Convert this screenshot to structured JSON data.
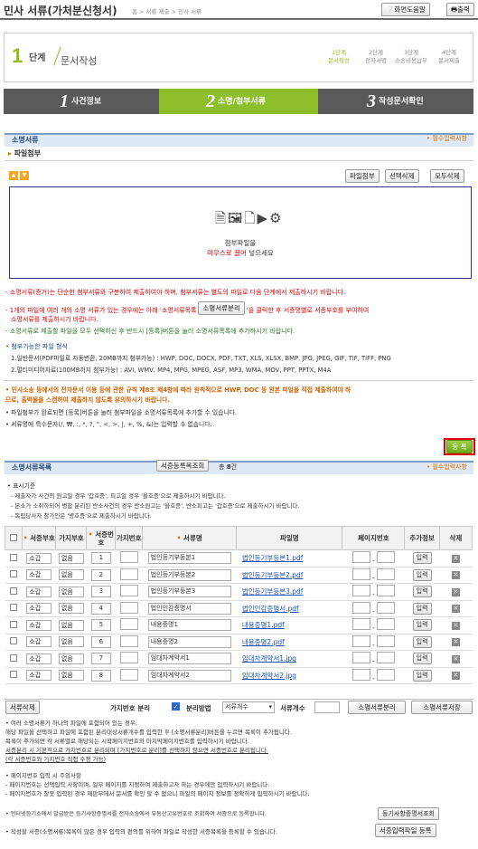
{
  "header": {
    "title": "민사 서류(가처분신청서)",
    "breadcrumb": "홈 > 서류 제출 > 민사 서류",
    "help_label": "화면도움말",
    "print_label": "출력"
  },
  "steps": {
    "current_num": "1",
    "current_unit": "단계",
    "current_name": "문서작성",
    "substeps": [
      [
        "1단계",
        "문서작성"
      ],
      [
        "2단계",
        "전자서명"
      ],
      [
        "3단계",
        "소송비용납부"
      ],
      [
        "4단계",
        "문서제출"
      ]
    ]
  },
  "tabs": [
    {
      "num": "1",
      "label": "사건정보"
    },
    {
      "num": "2",
      "label": "소명/첨부서류"
    },
    {
      "num": "3",
      "label": "작성문서확인"
    }
  ],
  "section1": {
    "title": "소명서류",
    "required": "• 필수입력사항",
    "attach_title": "파일첨부",
    "btn_attach": "파일첨부",
    "btn_delete_selected": "선택삭제",
    "btn_delete_all": "모두삭제",
    "drop_line1": "첨부파일을",
    "drop_line2_red": "마우스로 끌어",
    "drop_line2_rest": " 넣으세요"
  },
  "notes1": {
    "n1": "- 소명서류(증거)는 단순한 첨부서류와 구분하여 제출하여야 하며, 첨부서류는 별도의 파일로 다음 단계에서 제출하시기 바랍니다.",
    "n2a": "- 1개의 파일에 여러 개의 소명 서류가 있는 경우에는 아래 '소명서류목록",
    "n2btn": "소명서류분리",
    "n2b": "'을 클릭한 후 서증명별로 서증부호를 부여하여",
    "n2c": "소명서류를 제출하시기 바랍니다.",
    "n3": "- 소명서류로 제출할 파일을 모두 선택하신 후 반드시 [등록]버튼을 눌러 소명서류목록에 추가하시기 바랍니다.",
    "formats_title": "첨부가능한 파일 형식",
    "f1": "1.일반문서(PDF파일로 자동변환, 20MB까지 첨부가능) : HWP, DOC, DOCX, PDF, TXT, XLS, XLSX, BMP, JPG, JPEG, GIF, TIF, TIFF, PNG",
    "f2": "2.멀티미디어자료(100MB까지 첨부가능) : AVI, WMV, MP4, MPG, MPEG, ASF, MP3, WMA, MOV, PPT, PPTX, M4A",
    "w1": "• 민사소송 등에서의 전자문서 이용 등에 관한 규칙 제8조 제4항에 따라 원칙적으로 HWP, DOC 등 원본 파일을 직접 제출하여야 하",
    "w2": "  므로, 출력물을 스캔하여 제출하지 않도록 유의하시기 바랍니다.",
    "w3": "• 파일첨부가 완료되면 [등록]버튼을 눌러 첨부파일을 소명서류목록에 추가할 수 있습니다.",
    "w4": "• 서류명에 특수문자(/, ₩, :, *, ?, \", <, >, |, +, %, &)는 입력할 수 없습니다.",
    "register": "등 록"
  },
  "section2": {
    "title": "소명서류목록",
    "btn_lookup": "서증등록목조회",
    "count_prefix": "총",
    "count": "8",
    "count_suffix": "건",
    "required": "• 필수입력사항",
    "std_title": "• 표시기준",
    "s1": "- 제출자가 사건의 원고일 경우 '갑호증', 피고일 경우 '을호증'으로 제출하시기 바랍니다.",
    "s2": "- 본소가 소취하되어 병합 분리된 반소사건의 경우 반소원고는 '을호증', 반소피고는 '갑호증'으로 제출하시기 바랍니다.",
    "s3": "- 독립당사자 참가인은 '병호증'으로 제출하시기 바랍니다."
  },
  "table": {
    "headers": [
      "",
      "서증부호",
      "가지부호",
      "서증번호",
      "가지번호",
      "서류명",
      "파일명",
      "페이지번호",
      "추가정보",
      "삭제"
    ],
    "rows": [
      {
        "code": "소갑",
        "branch": "없음",
        "no": "1",
        "name": "법인등기부등본1",
        "file": "법인등기부등본1.pdf",
        "info": "입력"
      },
      {
        "code": "소갑",
        "branch": "없음",
        "no": "2",
        "name": "법인등기부등본2",
        "file": "법인등기부등본2.pdf",
        "info": "입력"
      },
      {
        "code": "소갑",
        "branch": "없음",
        "no": "3",
        "name": "법인등기부등본3",
        "file": "법인등기부등본3.pdf",
        "info": "입력"
      },
      {
        "code": "소갑",
        "branch": "없음",
        "no": "4",
        "name": "법인인감증명서",
        "file": "법인인감증명서.pdf",
        "info": "입력"
      },
      {
        "code": "소갑",
        "branch": "없음",
        "no": "5",
        "name": "내용증명1",
        "file": "내용증명1.pdf",
        "info": "입력"
      },
      {
        "code": "소갑",
        "branch": "없음",
        "no": "6",
        "name": "내용증명2",
        "file": "내용증명2.pdf",
        "info": "입력"
      },
      {
        "code": "소갑",
        "branch": "없음",
        "no": "7",
        "name": "임대차계약서1",
        "file": "임대차계약서1.jpg",
        "info": "입력"
      },
      {
        "code": "소갑",
        "branch": "없음",
        "no": "8",
        "name": "임대차계약서2",
        "file": "임대차계약서2.jpg",
        "info": "입력"
      }
    ]
  },
  "bottombar": {
    "btn_delete": "서류삭제",
    "branch_split": "가지번호 분리",
    "method_label": "분리방법",
    "method_value": "서류개수",
    "count_label": "서류개수",
    "btn_split": "소명서류분리",
    "btn_save": "소명서류저장"
  },
  "notes2": {
    "a1": "• 여러 소명서류가 하나의 파일에 포함되어 있는 경우,",
    "a2": "  해당 파일을 선택하고 파일에 포함된 분리대상서류개수를 입력한 후 [소명서류분리]버튼을 누르면 목록이 추가됩니다.",
    "a3": "  목록이 추가되면 각 서류별로 해당되는 시작페이지번호와 마지막페이지번호를 입력하시기 바랍니다.",
    "a4": "  서증분리 시 기본적으로 가지번호로 분리되며 [가지번호로 분리]를 선택하지 않으면 서증번호로 분리됩니다.",
    "a5": "  (각 서증번호와 가지번호 직접 수정 가능)",
    "b1": "• 페이지번호 입력 시 주의사항",
    "b2": "  - 페이지번호는 선택입력 사항이며, 일부 페이지를 지정하여 제출하고자 하는 경우에만 입력하시기 바랍니다.",
    "b3": "  - 페이지번호가 잘못 입력된 경우 재판부에서 문서를 확인 할 수 없으니 파일의 페이지 정보를 정확하게 입력하시기 바랍니다.",
    "c1": "• 인터넷등기소에서 발급받은 등기사항증명서를 전자소송에서 부동산고유번호로 조회하여 서증으로 등록합니다.",
    "c1btn": "등기사항증명서조회",
    "c2": "• 작성할 서증(소명서류)목록이 많은 경우 입력의 편의를 위하여 파일로 작성한 서증목록을 등록할 수 있습니다.",
    "c2btn": "서증입력파일 등록"
  },
  "colors": {
    "green": "#8cbf2a",
    "dark": "#5a5a5a",
    "red": "#dd0000",
    "orange": "#e07000"
  }
}
